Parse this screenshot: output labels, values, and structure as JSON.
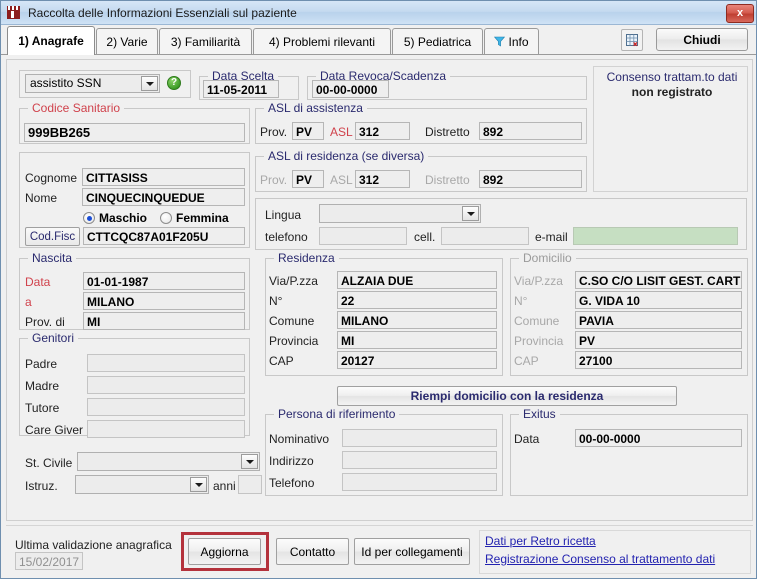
{
  "window": {
    "title": "Raccolta delle Informazioni Essenziali sul paziente",
    "close_label": "x",
    "icon": "castle-icon"
  },
  "tabs": [
    {
      "label": "1) Anagrafe",
      "active": true
    },
    {
      "label": "2) Varie",
      "active": false
    },
    {
      "label": "3) Familiarità",
      "active": false
    },
    {
      "label": "4) Problemi rilevanti",
      "active": false
    },
    {
      "label": "5) Pediatrica",
      "active": false
    },
    {
      "label": "Info",
      "active": false,
      "icon": "funnel-icon"
    }
  ],
  "toolbar": {
    "grid_icon": "grid-table-icon",
    "close_button": "Chiudi"
  },
  "assistance": {
    "type_value": "assistito SSN",
    "help_icon": "question-help-icon",
    "data_scelta_label": "Data Scelta",
    "data_scelta_value": "11-05-2011",
    "data_revoca_label": "Data Revoca/Scadenza",
    "data_revoca_value": "00-00-0000"
  },
  "consenso": {
    "title": "Consenso trattam.to dati",
    "status": "non registrato"
  },
  "codice_sanitario": {
    "label": "Codice Sanitario",
    "value": "999BB265"
  },
  "asl_assistenza": {
    "legend": "ASL di assistenza",
    "prov_label": "Prov.",
    "prov_value": "PV",
    "asl_label": "ASL",
    "asl_value": "312",
    "distretto_label": "Distretto",
    "distretto_value": "892"
  },
  "asl_residenza": {
    "legend": "ASL di residenza (se diversa)",
    "prov_label": "Prov.",
    "prov_value": "PV",
    "asl_label": "ASL",
    "asl_value": "312",
    "distretto_label": "Distretto",
    "distretto_value": "892"
  },
  "identity": {
    "cognome_label": "Cognome",
    "cognome_value": "CITTASISS",
    "nome_label": "Nome",
    "nome_value": "CINQUECINQUEDUE",
    "maschio_label": "Maschio",
    "femmina_label": "Femmina",
    "gender_selected": "Maschio",
    "codfisc_button": "Cod.Fisc",
    "codfisc_value": "CTTCQC87A01F205U"
  },
  "nascita": {
    "legend": "Nascita",
    "data_label": "Data",
    "data_value": "01-01-1987",
    "a_label": "a",
    "a_value": "MILANO",
    "prov_label": "Prov. di",
    "prov_value": "MI"
  },
  "genitori": {
    "legend": "Genitori",
    "rows": [
      {
        "label": "Padre",
        "value": ""
      },
      {
        "label": "Madre",
        "value": ""
      },
      {
        "label": "Tutore",
        "value": ""
      },
      {
        "label": "Care Giver",
        "value": ""
      }
    ]
  },
  "stato": {
    "civile_label": "St. Civile",
    "civile_value": "",
    "istruz_label": "Istruz.",
    "istruz_value": "",
    "anni_label": "anni",
    "anni_value": ""
  },
  "contatti": {
    "lingua_label": "Lingua",
    "lingua_value": "",
    "telefono_label": "telefono",
    "telefono_value": "",
    "cell_label": "cell.",
    "cell_value": "",
    "email_label": "e-mail",
    "email_value": ""
  },
  "residenza": {
    "legend": "Residenza",
    "via_label": "Via/P.zza",
    "via_value": "ALZAIA DUE",
    "n_label": "N°",
    "n_value": "22",
    "comune_label": "Comune",
    "comune_value": "MILANO",
    "provincia_label": "Provincia",
    "provincia_value": "MI",
    "cap_label": "CAP",
    "cap_value": "20127"
  },
  "domicilio": {
    "legend": "Domicilio",
    "via_label": "Via/P.zza",
    "via_value": "C.SO C/O LISIT   GEST. CARTE",
    "n_label": "N°",
    "n_value": "G. VIDA 10",
    "comune_label": "Comune",
    "comune_value": "PAVIA",
    "provincia_label": "Provincia",
    "provincia_value": "PV",
    "cap_label": "CAP",
    "cap_value": "27100"
  },
  "fill_button": "Riempi domicilio con la residenza",
  "persona_riferimento": {
    "legend": "Persona di riferimento",
    "nominativo_label": "Nominativo",
    "nominativo_value": "",
    "indirizzo_label": "Indirizzo",
    "indirizzo_value": "",
    "telefono_label": "Telefono",
    "telefono_value": ""
  },
  "exitus": {
    "legend": "Exitus",
    "data_label": "Data",
    "data_value": "00-00-0000"
  },
  "footer": {
    "validazione_label": "Ultima validazione anagrafica",
    "validazione_date": "15/02/2017",
    "aggiorna_button": "Aggiorna",
    "contatto_button": "Contatto",
    "id_button": "Id per collegamenti",
    "link_retro": "Dati per Retro ricetta",
    "link_consenso": "Registrazione Consenso al trattamento dati"
  },
  "colors": {
    "accent_blue": "#2a2a6e",
    "label_red": "#d0424c",
    "link": "#2323b0",
    "highlight": "#b4323c",
    "email_green": "#c6dfc2"
  }
}
